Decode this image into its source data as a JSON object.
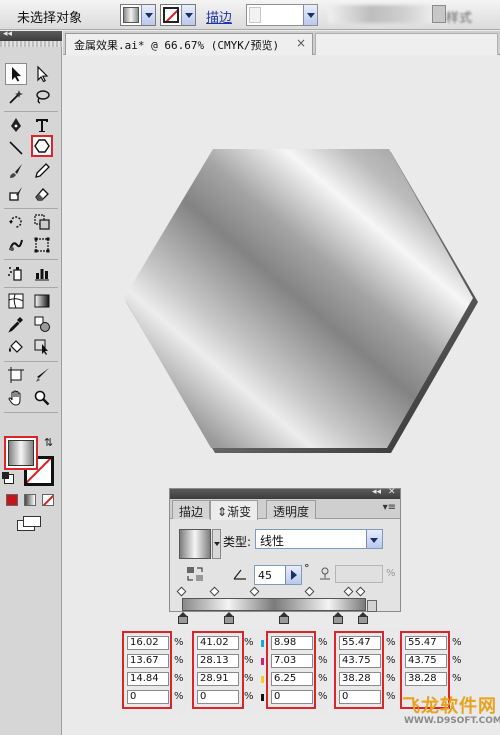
{
  "control_bar": {
    "status": "未选择对象",
    "stroke_label": "描边",
    "blurred_tail": "样式"
  },
  "document": {
    "tab_title": "金属效果.ai* @ 66.67% (CMYK/预览)",
    "close_glyph": "×"
  },
  "gradient_panel": {
    "tabs": [
      "描边",
      "渐变",
      "透明度"
    ],
    "active_tab": "渐变",
    "type_label": "类型:",
    "type_value": "线性",
    "angle": "45",
    "degree_sign": "°",
    "location_unit": "%",
    "stops_count": 5
  },
  "stop_values": {
    "columns": [
      {
        "values": [
          "16.02",
          "13.67",
          "14.84",
          "0"
        ],
        "unit": "%"
      },
      {
        "values": [
          "41.02",
          "28.13",
          "28.91",
          "0"
        ],
        "unit": "%"
      },
      {
        "values": [
          "8.98",
          "7.03",
          "6.25",
          "0"
        ],
        "unit": "%"
      },
      {
        "values": [
          "55.47",
          "43.75",
          "38.28",
          "0"
        ],
        "unit": "%"
      },
      {
        "values": [
          "55.47",
          "43.75",
          "38.28"
        ],
        "unit": "%"
      }
    ]
  },
  "watermark": {
    "brand": "飞龙软件网",
    "url": "WWW.D9SOFT.COM"
  },
  "colors": {
    "highlight_box": "#d7262c",
    "stroke_link": "#1d35a8",
    "watermark": "#e8a21c"
  },
  "icons": [
    "selection-icon",
    "direct-selection-icon",
    "magic-wand-icon",
    "lasso-icon",
    "pen-icon",
    "type-icon",
    "line-icon",
    "polygon-icon",
    "paintbrush-icon",
    "pencil-icon",
    "blob-brush-icon",
    "eraser-icon",
    "rotate-icon",
    "scale-icon",
    "warp-icon",
    "free-transform-icon",
    "symbol-sprayer-icon",
    "column-graph-icon",
    "mesh-icon",
    "gradient-icon",
    "eyedropper-icon",
    "blend-icon",
    "live-paint-bucket-icon",
    "live-paint-selection-icon",
    "artboard-icon",
    "slice-icon",
    "hand-icon",
    "zoom-icon"
  ]
}
